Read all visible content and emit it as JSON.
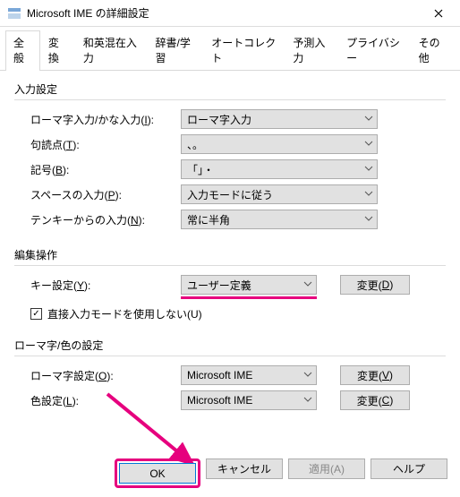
{
  "window": {
    "title": "Microsoft IME の詳細設定"
  },
  "tabs": [
    "全般",
    "変換",
    "和英混在入力",
    "辞書/学習",
    "オートコレクト",
    "予測入力",
    "プライバシー",
    "その他"
  ],
  "group1": {
    "title": "入力設定",
    "r1_label_pre": "ローマ字入力/かな入力(",
    "r1_hot": "I",
    "r1_label_post": "):",
    "r1_value": "ローマ字入力",
    "r2_label_pre": "句読点(",
    "r2_hot": "T",
    "r2_label_post": "):",
    "r2_value": "、。",
    "r3_label_pre": "記号(",
    "r3_hot": "B",
    "r3_label_post": "):",
    "r3_value": "「」・",
    "r4_label_pre": "スペースの入力(",
    "r4_hot": "P",
    "r4_label_post": "):",
    "r4_value": "入力モードに従う",
    "r5_label_pre": "テンキーからの入力(",
    "r5_hot": "N",
    "r5_label_post": "):",
    "r5_value": "常に半角"
  },
  "group2": {
    "title": "編集操作",
    "r1_label_pre": "キー設定(",
    "r1_hot": "Y",
    "r1_label_post": "):",
    "r1_value": "ユーザー定義",
    "btn1_pre": "変更(",
    "btn1_hot": "D",
    "btn1_post": ")",
    "check_pre": "直接入力モードを使用しない(",
    "check_hot": "U",
    "check_post": ")",
    "checked": true
  },
  "group3": {
    "title": "ローマ字/色の設定",
    "r1_label_pre": "ローマ字設定(",
    "r1_hot": "O",
    "r1_label_post": "):",
    "r1_value": "Microsoft IME",
    "btn1_pre": "変更(",
    "btn1_hot": "V",
    "btn1_post": ")",
    "r2_label_pre": "色設定(",
    "r2_hot": "L",
    "r2_label_post": "):",
    "r2_value": "Microsoft IME",
    "btn2_pre": "変更(",
    "btn2_hot": "C",
    "btn2_post": ")"
  },
  "footer": {
    "ok": "OK",
    "cancel": "キャンセル",
    "apply_pre": "適用(",
    "apply_hot": "A",
    "apply_post": ")",
    "help": "ヘルプ"
  }
}
